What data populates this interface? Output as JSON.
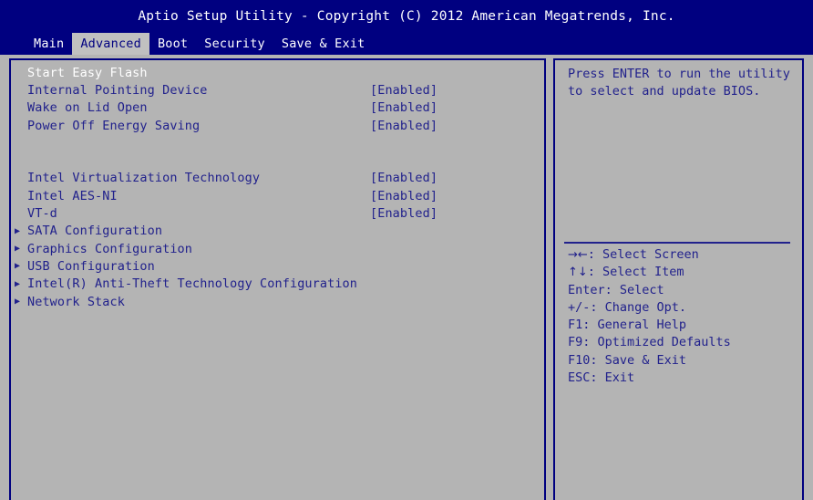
{
  "titlebar": {
    "title": "Aptio Setup Utility - Copyright (C) 2012 American Megatrends, Inc."
  },
  "menubar": {
    "tabs": [
      {
        "label": "Main",
        "active": false
      },
      {
        "label": "Advanced",
        "active": true
      },
      {
        "label": "Boot",
        "active": false
      },
      {
        "label": "Security",
        "active": false
      },
      {
        "label": "Save & Exit",
        "active": false
      }
    ]
  },
  "settings": {
    "rows": [
      {
        "label": "Start Easy Flash",
        "value": "",
        "submenu": false,
        "selected": true
      },
      {
        "label": "Internal Pointing Device",
        "value": "[Enabled]",
        "submenu": false,
        "selected": false
      },
      {
        "label": "Wake on Lid Open",
        "value": "[Enabled]",
        "submenu": false,
        "selected": false
      },
      {
        "label": "Power Off Energy Saving",
        "value": "[Enabled]",
        "submenu": false,
        "selected": false
      },
      {
        "label": "",
        "value": "",
        "submenu": false,
        "selected": false,
        "spacer": true
      },
      {
        "label": "",
        "value": "",
        "submenu": false,
        "selected": false,
        "spacer": true
      },
      {
        "label": "Intel Virtualization Technology",
        "value": "[Enabled]",
        "submenu": false,
        "selected": false
      },
      {
        "label": "Intel AES-NI",
        "value": "[Enabled]",
        "submenu": false,
        "selected": false
      },
      {
        "label": "VT-d",
        "value": "[Enabled]",
        "submenu": false,
        "selected": false
      },
      {
        "label": "SATA Configuration",
        "value": "",
        "submenu": true,
        "selected": false
      },
      {
        "label": "Graphics Configuration",
        "value": "",
        "submenu": true,
        "selected": false
      },
      {
        "label": "USB Configuration",
        "value": "",
        "submenu": true,
        "selected": false
      },
      {
        "label": "Intel(R) Anti-Theft Technology Configuration",
        "value": "",
        "submenu": true,
        "selected": false
      },
      {
        "label": "Network Stack",
        "value": "",
        "submenu": true,
        "selected": false
      }
    ],
    "submenu_marker": "▶"
  },
  "help": {
    "description_line1": "Press ENTER to run the utility",
    "description_line2": "to select and update BIOS.",
    "keys": [
      {
        "glyph": "→←",
        "text": ": Select Screen"
      },
      {
        "glyph": "↑↓",
        "text": ": Select Item"
      },
      {
        "glyph": "",
        "text": "Enter: Select"
      },
      {
        "glyph": "",
        "text": "+/-: Change Opt."
      },
      {
        "glyph": "",
        "text": "F1: General Help"
      },
      {
        "glyph": "",
        "text": "F9: Optimized Defaults"
      },
      {
        "glyph": "",
        "text": "F10: Save & Exit"
      },
      {
        "glyph": "",
        "text": "ESC: Exit"
      }
    ]
  },
  "colors": {
    "background_blue": "#000080",
    "panel_gray": "#b4b4b4",
    "text_blue": "#21218c",
    "text_white": "#ffffff",
    "tab_active_bg": "#c0c0c0"
  }
}
